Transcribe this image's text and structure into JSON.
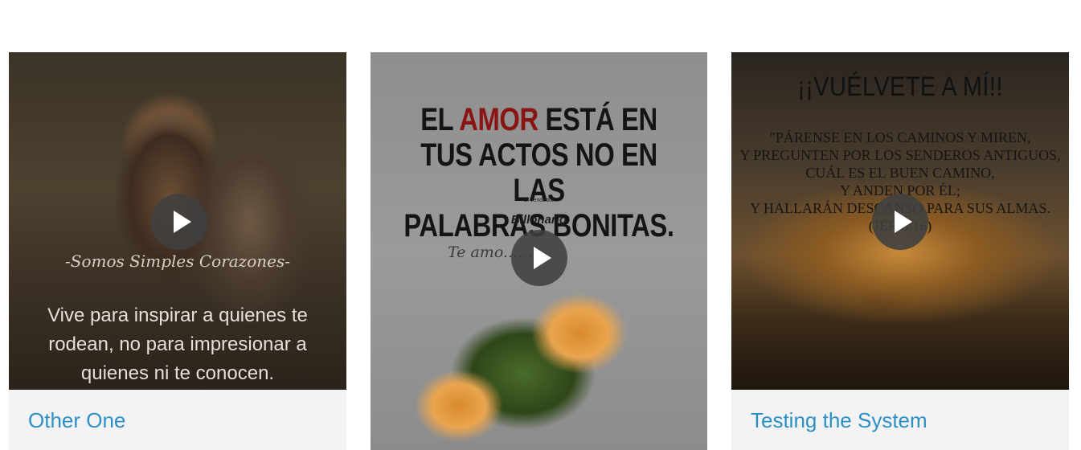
{
  "cards": [
    {
      "title": "Other One",
      "image": {
        "script_text": "-Somos Simples Corazones-",
        "quote": "Vive para inspirar a quienes te rodean, no para impresionar a quienes ni te conocen."
      },
      "play_icon": "play-icon"
    },
    {
      "title": "",
      "image": {
        "headline_part1": "EL ",
        "headline_red": "AMOR",
        "headline_part2": " ESTÁ EN",
        "headline_line2": "TUS ACTOS NO EN LAS",
        "headline_line3": "PALABRAS BONITAS.",
        "brand_small": "El vendedor",
        "brand": "Billonario",
        "script_text": "Te amo......"
      },
      "play_icon": "play-icon"
    },
    {
      "title": "Testing the System",
      "image": {
        "heading": "¡¡VUÉLVETE A MÍ!!",
        "lines": [
          "\"PÁRENSE EN LOS CAMINOS Y MIREN,",
          "Y PREGUNTEN POR LOS SENDEROS ANTIGUOS,",
          "CUÁL ES EL BUEN CAMINO,",
          "Y ANDEN POR ÉL;",
          "Y HALLARÁN DESCANSO PARA SUS ALMAS.",
          "(JER 6:16)"
        ]
      },
      "play_icon": "play-icon"
    }
  ],
  "colors": {
    "caption_link": "#2c8fc6",
    "card_background": "#f3f3f3"
  }
}
